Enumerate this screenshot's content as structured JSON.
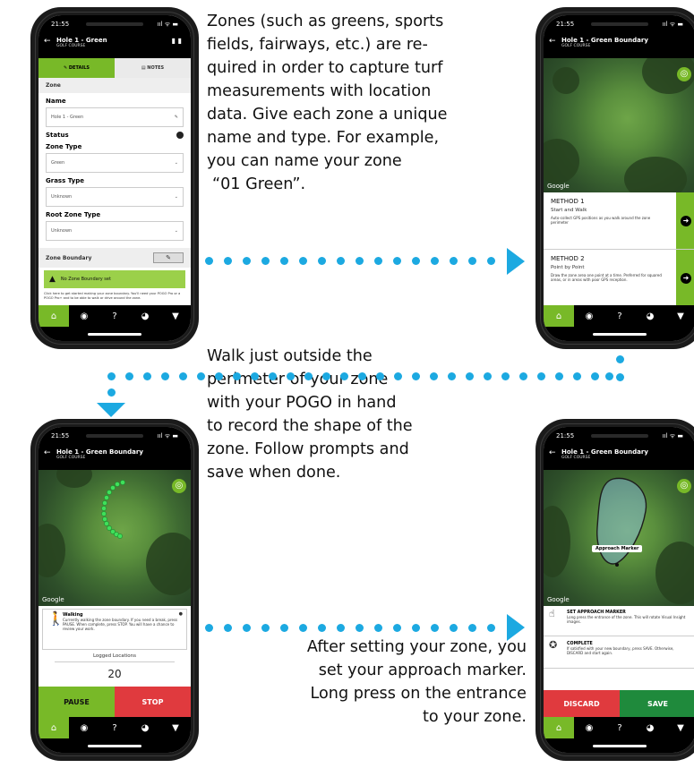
{
  "status_bar": {
    "time": "21:55",
    "icons": "ııl ᯤ ▬"
  },
  "nav_icons": [
    "⌂",
    "◉",
    "?",
    "◕",
    "▼"
  ],
  "colors": {
    "accent_green": "#78b928",
    "arrow_blue": "#1ca9e1",
    "stop_red": "#e03a3e",
    "save_green": "#1f8a3c"
  },
  "captions": {
    "c1": [
      "Zones (such as greens, sports",
      "fields, fairways, etc.) are re-",
      "quired in order to capture turf",
      "measurements with location",
      "data. Give each zone a unique",
      "name and type. For example,",
      "you can name your zone",
      "“01 Green”."
    ],
    "c2": [
      "Walk just outside the",
      "perimeter of your zone",
      "with your POGO in hand",
      "to record the shape of the",
      "zone. Follow prompts and",
      "save when done."
    ],
    "c3": [
      "After setting your zone, you",
      "set your approach marker.",
      "Long press on the entrance",
      "to your zone."
    ]
  },
  "phone1": {
    "title": "Hole 1 - Green",
    "subtitle": "GOLF COURSE",
    "tabs": [
      "DETAILS",
      "NOTES"
    ],
    "section_zone": "Zone",
    "name_label": "Name",
    "name_value": "Hole 1 - Green",
    "status_label": "Status",
    "zone_type_label": "Zone Type",
    "zone_type_value": "Green",
    "grass_type_label": "Grass Type",
    "grass_type_value": "Unknown",
    "root_zone_label": "Root Zone Type",
    "root_zone_value": "Unknown",
    "boundary_label": "Zone Boundary",
    "no_boundary": "No Zone Boundary set",
    "help_text": "Click here to get started making your zone boundary. You'll need your POGO Pro or a POGO Pro+ and to be able to walk or drive around the zone."
  },
  "phone2": {
    "title": "Hole 1 - Green Boundary",
    "subtitle": "GOLF COURSE",
    "google": "Google",
    "m1_title": "METHOD 1",
    "m1_sub": "Start and Walk",
    "m1_desc": "Auto-collect GPS positions as you walk around the zone perimeter",
    "m2_title": "METHOD 2",
    "m2_sub": "Point by Point",
    "m2_desc": "Draw the zone area one point at a time. Preferred for squared areas, or in areas with poor GPS reception."
  },
  "phone3": {
    "title": "Hole 1 - Green Boundary",
    "subtitle": "GOLF COURSE",
    "google": "Google",
    "walking_title": "Walking",
    "walking_desc": "Currently walking the zone boundary. If you need a break, press PAUSE. When complete, press STOP. You will have a chance to review your work.",
    "logged_label": "Logged Locations",
    "logged_count": "20",
    "pause": "PAUSE",
    "stop": "STOP"
  },
  "phone4": {
    "title": "Hole 1 - Green Boundary",
    "subtitle": "GOLF COURSE",
    "google": "Google",
    "marker_label": "Approach Marker",
    "set_title": "SET APPROACH MARKER",
    "set_desc": "Long press the entrance of the zone. This will rotate Visual Insight images.",
    "complete_title": "COMPLETE",
    "complete_desc": "If satisfied with your new boundary, press SAVE. Otherwise, DISCARD and start again.",
    "discard": "DISCARD",
    "save": "SAVE"
  }
}
